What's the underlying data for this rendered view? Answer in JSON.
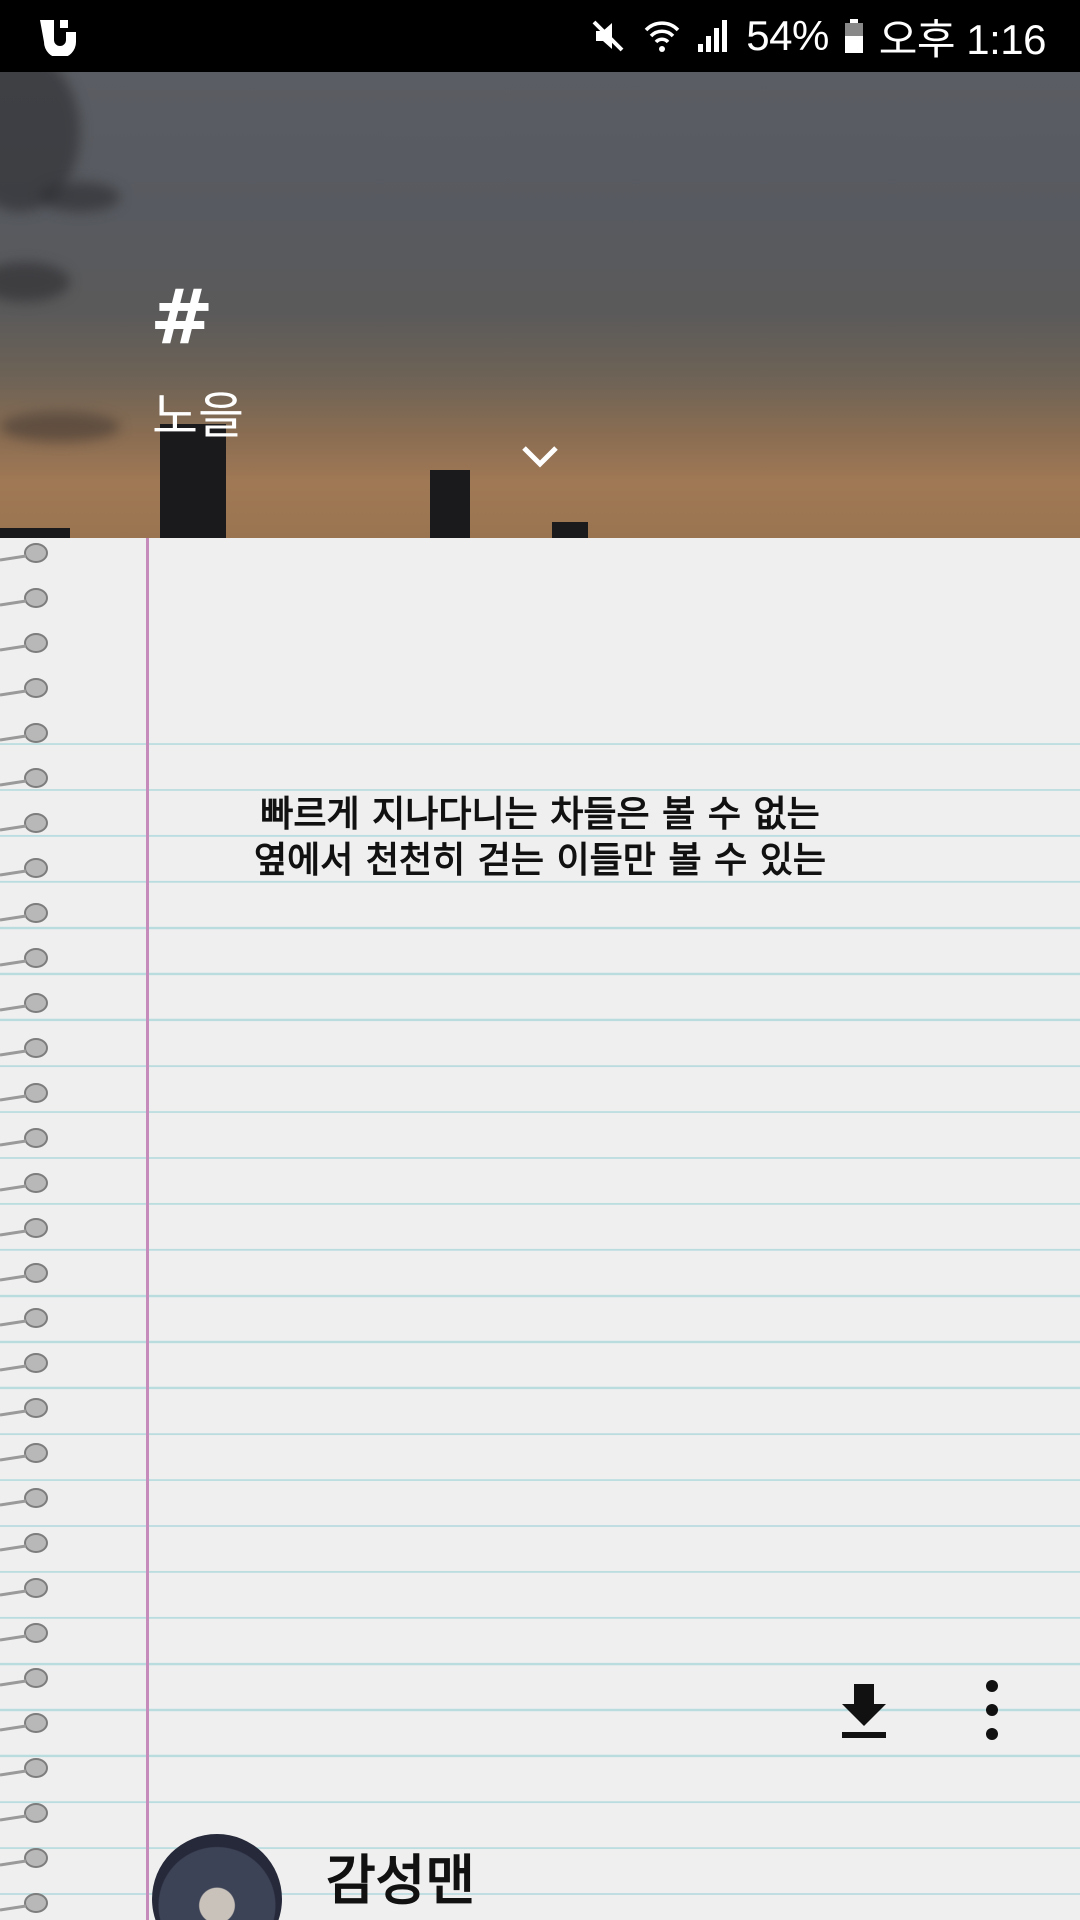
{
  "status_bar": {
    "battery": "54%",
    "time": "오후 1:16",
    "icons": [
      "app-logo-icon",
      "mute-icon",
      "wifi-icon",
      "signal-icon",
      "battery-icon"
    ]
  },
  "header": {
    "hash": "#",
    "tag": "노을",
    "expand_icon": "chevron-down-icon"
  },
  "post": {
    "lines": [
      "빠르게 지나다니는 차들은 볼 수 없는",
      "옆에서 천천히 걷는 이들만 볼 수 있는"
    ],
    "actions": {
      "download_icon": "download-icon",
      "more_icon": "more-vertical-icon"
    },
    "author": {
      "name": "감성맨"
    }
  },
  "colors": {
    "paper": "#efefef",
    "rule_line": "#b9dcdf",
    "margin_line": "#c48bbb"
  }
}
